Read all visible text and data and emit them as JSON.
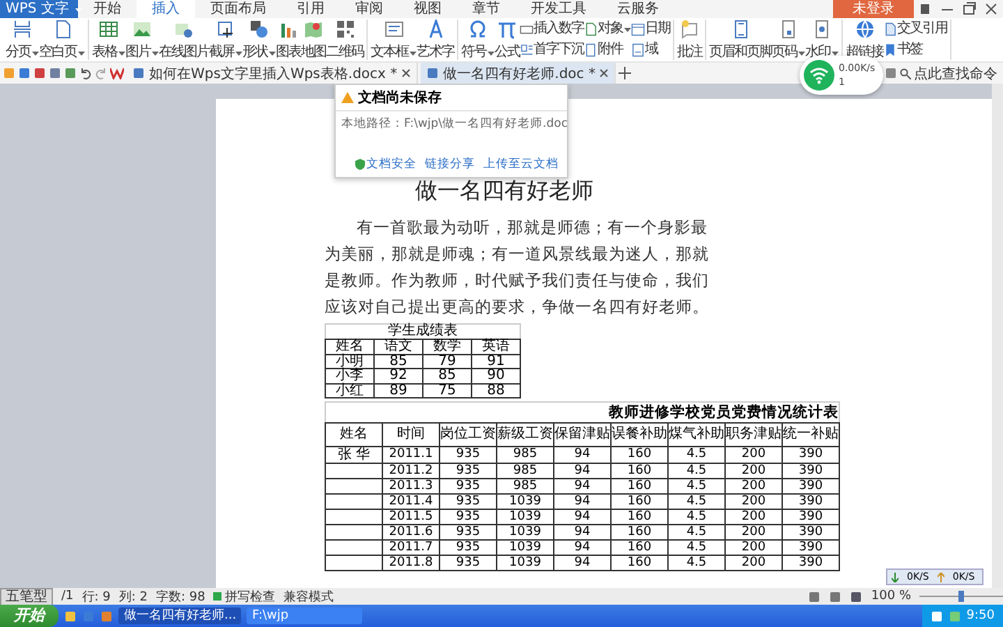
{
  "app": {
    "title": "WPS 文字",
    "login": "未登录"
  },
  "menu_tabs": [
    {
      "label": "开始",
      "selected": false
    },
    {
      "label": "插入",
      "selected": true
    },
    {
      "label": "页面布局",
      "selected": false
    },
    {
      "label": "引用",
      "selected": false
    },
    {
      "label": "审阅",
      "selected": false
    },
    {
      "label": "视图",
      "selected": false
    },
    {
      "label": "章节",
      "selected": false
    },
    {
      "label": "开发工具",
      "selected": false
    },
    {
      "label": "云服务",
      "selected": false
    }
  ],
  "ribbon_groups": [
    {
      "items": [
        {
          "kind": "large",
          "label": "分页",
          "dropdown": true
        },
        {
          "kind": "large",
          "label": "空白页",
          "dropdown": true
        }
      ]
    },
    {
      "items": [
        {
          "kind": "large",
          "label": "表格",
          "dropdown": true
        },
        {
          "kind": "large",
          "label": "图片",
          "dropdown": true
        },
        {
          "kind": "large",
          "label": "在线图片",
          "dropdown": false
        },
        {
          "kind": "large",
          "label": "截屏",
          "dropdown": true
        },
        {
          "kind": "large",
          "label": "形状",
          "dropdown": true
        },
        {
          "kind": "large",
          "label": "图表",
          "dropdown": false
        },
        {
          "kind": "large",
          "label": "地图",
          "dropdown": false
        },
        {
          "kind": "large",
          "label": "二维码",
          "dropdown": false
        }
      ]
    },
    {
      "items": [
        {
          "kind": "large",
          "label": "文本框",
          "dropdown": true
        },
        {
          "kind": "large",
          "label": "艺术字",
          "dropdown": false
        }
      ]
    },
    {
      "items": [
        {
          "kind": "large",
          "label": "符号",
          "dropdown": true
        },
        {
          "kind": "large",
          "label": "公式",
          "dropdown": false
        },
        {
          "kind": "small",
          "label": "插入数字",
          "dropdown": false
        },
        {
          "kind": "small",
          "label": "首字下沉",
          "dropdown": false
        },
        {
          "kind": "small",
          "label": "对象",
          "dropdown": true
        },
        {
          "kind": "small",
          "label": "附件",
          "dropdown": false
        },
        {
          "kind": "small",
          "label": "日期",
          "dropdown": false
        },
        {
          "kind": "small",
          "label": "域",
          "dropdown": false
        }
      ]
    },
    {
      "items": [
        {
          "kind": "large",
          "label": "批注",
          "dropdown": false
        }
      ]
    },
    {
      "items": [
        {
          "kind": "large",
          "label": "页眉和页脚",
          "dropdown": false
        },
        {
          "kind": "large",
          "label": "页码",
          "dropdown": true
        },
        {
          "kind": "large",
          "label": "水印",
          "dropdown": true
        }
      ]
    },
    {
      "items": [
        {
          "kind": "large",
          "label": "超链接",
          "dropdown": false
        },
        {
          "kind": "small",
          "label": "交叉引用",
          "dropdown": false
        },
        {
          "kind": "small",
          "label": "书签",
          "dropdown": false
        }
      ]
    }
  ],
  "doc_tabs": [
    {
      "label": "如何在Wps文字里插入Wps表格.docx *",
      "selected": false
    },
    {
      "label": "做一名四有好老师.doc *",
      "selected": true
    }
  ],
  "search": {
    "placeholder": "点此查找命令"
  },
  "network": {
    "speed": "0.00K/s",
    "count": "1"
  },
  "unsaved_popup": {
    "title": "文档尚未保存",
    "path": "本地路径：F:\\wjp\\做一名四有好老师.doc",
    "links": [
      "文档安全",
      "链接分享",
      "上传至云文档"
    ]
  },
  "document": {
    "title": "做一名四有好老师",
    "paragraph": "有一首歌最为动听，那就是师德；有一个身影最为美丽，那就是师魂；有一道风景线最为迷人，那就是教师。作为教师，时代赋予我们责任与使命，我们应该对自己提出更高的要求，争做一名四有好老师。",
    "score_table": {
      "title": "学生成绩表",
      "columns": [
        "姓名",
        "语文",
        "数学",
        "英语"
      ],
      "rows": [
        [
          "小明",
          "85",
          "79",
          "91"
        ],
        [
          "小李",
          "92",
          "85",
          "90"
        ],
        [
          "小红",
          "89",
          "75",
          "88"
        ]
      ]
    },
    "fee_table": {
      "title": "教师进修学校党员党费情况统计表",
      "columns": [
        "姓名",
        "时间",
        "岗位工资",
        "薪级工资",
        "保留津贴",
        "误餐补助",
        "煤气补助",
        "职务津贴",
        "统一补贴"
      ],
      "rows": [
        [
          "张 华",
          "2011.1",
          "935",
          "985",
          "94",
          "160",
          "4.5",
          "200",
          "390"
        ],
        [
          "",
          "2011.2",
          "935",
          "985",
          "94",
          "160",
          "4.5",
          "200",
          "390"
        ],
        [
          "",
          "2011.3",
          "935",
          "985",
          "94",
          "160",
          "4.5",
          "200",
          "390"
        ],
        [
          "",
          "2011.4",
          "935",
          "1039",
          "94",
          "160",
          "4.5",
          "200",
          "390"
        ],
        [
          "",
          "2011.5",
          "935",
          "1039",
          "94",
          "160",
          "4.5",
          "200",
          "390"
        ],
        [
          "",
          "2011.6",
          "935",
          "1039",
          "94",
          "160",
          "4.5",
          "200",
          "390"
        ],
        [
          "",
          "2011.7",
          "935",
          "1039",
          "94",
          "160",
          "4.5",
          "200",
          "390"
        ],
        [
          "",
          "2011.8",
          "935",
          "1039",
          "94",
          "160",
          "4.5",
          "200",
          "390"
        ]
      ]
    }
  },
  "net_monitor": {
    "down": "0K/S",
    "up": "0K/S"
  },
  "status_bar": {
    "ime": "五笔型",
    "page": "/1",
    "row": "行: 9",
    "col": "列: 2",
    "words": "字数: 98",
    "spell": {
      "label": "拼写检查",
      "checked": true
    },
    "mode": "兼容模式",
    "zoom": "100 %",
    "zoom_slider": {
      "level": 0.5
    }
  },
  "taskbar": {
    "start": "开始",
    "tasks": [
      {
        "label": "做一名四有好老师...",
        "selected": true
      },
      {
        "label": "F:\\wjp",
        "selected": false
      }
    ],
    "clock": "9:50"
  }
}
